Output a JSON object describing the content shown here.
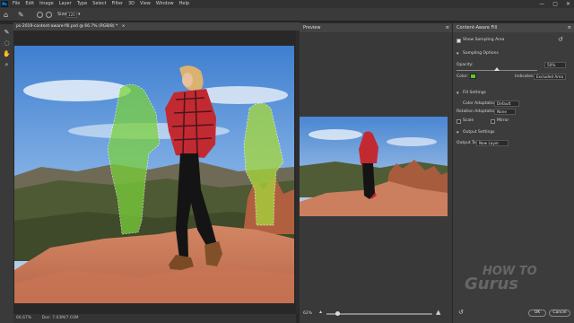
{
  "menubar": {
    "logo": "Ps",
    "items": [
      "File",
      "Edit",
      "Image",
      "Layer",
      "Type",
      "Select",
      "Filter",
      "3D",
      "View",
      "Window",
      "Help"
    ],
    "window_controls": [
      "—",
      "▢",
      "✕"
    ]
  },
  "optionsbar": {
    "size_label": "Size:",
    "size_value": "120"
  },
  "document": {
    "tab_title": "ps-2019-content-aware-fill.psd @ 66.7% (RGB/8) *",
    "tab_close": "×",
    "status_zoom": "66.67%",
    "status_doc": "Doc: 7.03M/7.03M"
  },
  "preview": {
    "title": "Preview",
    "zoom_value": "62%"
  },
  "caf": {
    "title": "Content-Aware Fill",
    "show_sampling_area": "Show Sampling Area",
    "sampling_options": "Sampling Options",
    "opacity_label": "Opacity:",
    "opacity_value": "50%",
    "opacity_fraction": 0.5,
    "color_label": "Color:",
    "sampling_color": "#5ec72a",
    "indicates_label": "Indicates:",
    "indicates_value": "Excluded Area",
    "fill_settings": "Fill Settings",
    "color_adaptation_label": "Color Adaptation:",
    "color_adaptation_value": "Default",
    "rotation_adaptation_label": "Rotation Adaptation:",
    "rotation_adaptation_value": "None",
    "scale_label": "Scale",
    "mirror_label": "Mirror",
    "output_settings": "Output Settings",
    "output_to_label": "Output To:",
    "output_to_value": "New Layer",
    "ok_label": "OK",
    "cancel_label": "Cancel"
  },
  "watermark": {
    "line1": "HOW TO",
    "line2": "Gurus"
  }
}
